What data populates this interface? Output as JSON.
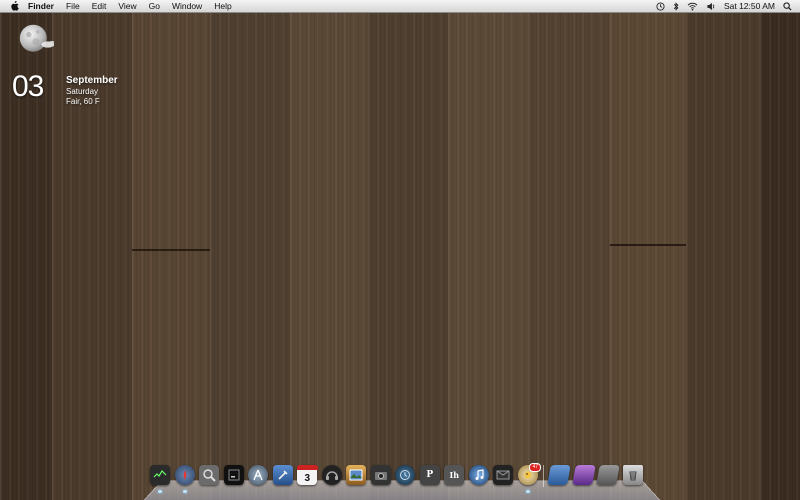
{
  "menubar": {
    "apple_icon": "apple-icon",
    "app_name": "Finder",
    "items": [
      "File",
      "Edit",
      "View",
      "Go",
      "Window",
      "Help"
    ],
    "status_icons": [
      "time-machine-icon",
      "bluetooth-icon",
      "wifi-icon",
      "volume-icon"
    ],
    "clock": "Sat 12:50 AM",
    "spotlight_icon": "spotlight-search-icon"
  },
  "widget": {
    "day": "03",
    "month": "September",
    "weekday": "Saturday",
    "weather": "Fair, 60 F",
    "icon": "moon-cloud-icon"
  },
  "dock": {
    "apps": [
      {
        "name": "activity-monitor",
        "color": "#2b2b2b",
        "running": true
      },
      {
        "name": "safari",
        "color": "#3a4d6b",
        "running": true
      },
      {
        "name": "preview",
        "color": "#6b6b6b",
        "running": false
      },
      {
        "name": "terminal",
        "color": "#111111",
        "running": false
      },
      {
        "name": "app-store",
        "color": "#5b6b7b",
        "running": false
      },
      {
        "name": "xcode",
        "color": "#3b6fb2",
        "running": false
      },
      {
        "name": "calendar",
        "color": "#f4f4f4",
        "running": false,
        "label": "3"
      },
      {
        "name": "headphones",
        "color": "#222222",
        "running": false
      },
      {
        "name": "iphoto",
        "color": "#c48a35",
        "running": false
      },
      {
        "name": "camera",
        "color": "#333333",
        "running": false
      },
      {
        "name": "time-machine",
        "color": "#1e3b53",
        "running": false
      },
      {
        "name": "pages",
        "color": "#444444",
        "running": false
      },
      {
        "name": "typeface",
        "color": "#555555",
        "running": false
      },
      {
        "name": "itunes",
        "color": "#1f4f8f",
        "running": false
      },
      {
        "name": "mail-stack",
        "color": "#222222",
        "running": false
      },
      {
        "name": "adium",
        "color": "#d4c089",
        "running": true,
        "badge": "47"
      }
    ],
    "folders": [
      {
        "name": "applications-stack",
        "color": "#4a7ab8"
      },
      {
        "name": "documents-stack",
        "color": "#8a4ab8"
      },
      {
        "name": "downloads-stack",
        "color": "#6b6b6b"
      }
    ],
    "trash": {
      "name": "trash"
    }
  }
}
